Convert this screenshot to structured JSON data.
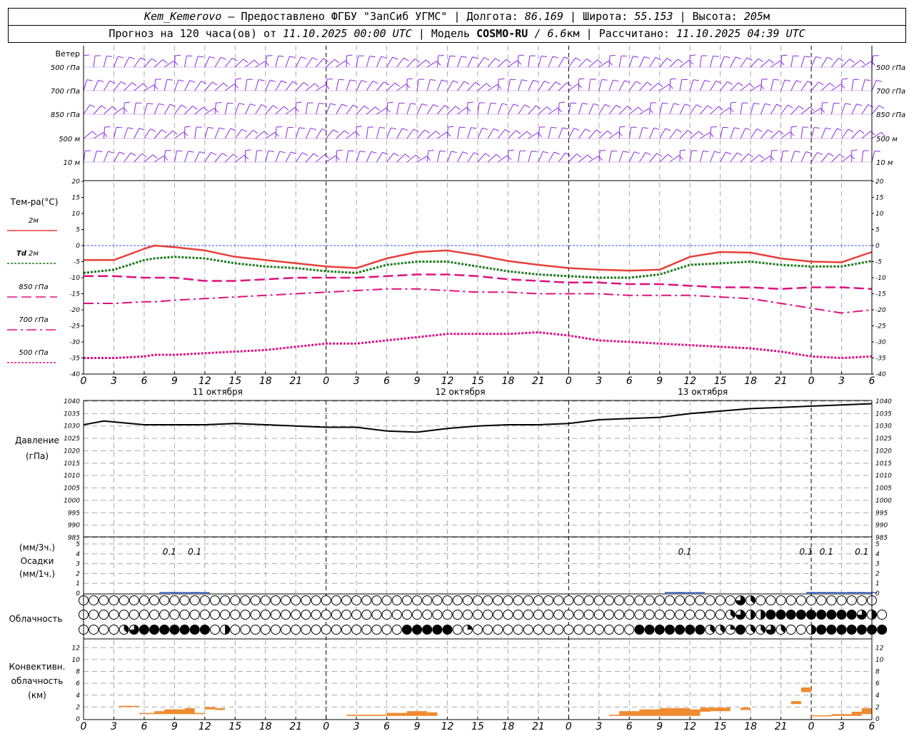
{
  "header": {
    "station": "Kem_Kemerovo",
    "dash": "—",
    "provider": "Предоставлено ФГБУ \"ЗапСиб УГМС\"",
    "sep": "|",
    "lon_label": "Долгота:",
    "lon_value": "86.169",
    "lat_label": "Широта:",
    "lat_value": "55.153",
    "alt_label": "Высота:",
    "alt_value": "205",
    "alt_unit": "м",
    "forecast_label": "Прогноз на 120 часа(ов) от",
    "forecast_start": "11.10.2025 00:00 UTC",
    "model_label": "Модель",
    "model_name": "COSMO-RU",
    "model_res_sep": "/",
    "model_res": "6.6",
    "model_res_unit": "км",
    "computed_label": "Рассчитано:",
    "computed_value": "11.10.2025 04:39 UTC"
  },
  "hour_ticks": [
    "0",
    "3",
    "6",
    "9",
    "12",
    "15",
    "18",
    "21",
    "0",
    "3",
    "6",
    "9",
    "12",
    "15",
    "18",
    "21",
    "0",
    "3",
    "6",
    "9",
    "12",
    "15",
    "18",
    "21",
    "0",
    "3",
    "6"
  ],
  "day_labels": [
    "11 октября",
    "12 октября",
    "13 октября"
  ],
  "colors": {
    "wind": "#8a2be2",
    "t2m": "#e8403a",
    "td2m": "#1a7a1a",
    "t850": "#e0107f",
    "t700": "#e0107f",
    "t500": "#e0107f",
    "zero_line": "#3355ff",
    "pressure": "#000000",
    "precip": "#2255cc",
    "convective": "#f08a30",
    "grid": "#aaaaaa"
  },
  "wind_panel": {
    "title": "Ветер",
    "levels": [
      "500 гПа",
      "700 гПа",
      "850 гПа",
      "500 м",
      "10 м"
    ]
  },
  "temp_panel": {
    "title": "Тем-ра(°C)",
    "legend": [
      {
        "label": "2м",
        "prefix": ""
      },
      {
        "label": "2м",
        "prefix": "Td"
      },
      {
        "label": "850 гПа",
        "prefix": ""
      },
      {
        "label": "700 гПа",
        "prefix": ""
      },
      {
        "label": "500 гПа",
        "prefix": ""
      }
    ],
    "yticks": [
      "20",
      "15",
      "10",
      "5",
      "0",
      "-5",
      "-10",
      "-15",
      "-20",
      "-25",
      "-30",
      "-35",
      "-40"
    ]
  },
  "pressure_panel": {
    "title": "Давление",
    "unit": "(гПа)",
    "yticks": [
      "1040",
      "1035",
      "1030",
      "1025",
      "1020",
      "1015",
      "1010",
      "1005",
      "1000",
      "995",
      "990",
      "985"
    ]
  },
  "precip_panel": {
    "unit1": "(мм/3ч.)",
    "title": "Осадки",
    "unit2": "(мм/1ч.)",
    "yticks": [
      "5",
      "4",
      "3",
      "2",
      "1",
      "0"
    ],
    "labels": [
      {
        "hour": 8.5,
        "text": "0.1"
      },
      {
        "hour": 11,
        "text": "0.1"
      },
      {
        "hour": 59.5,
        "text": "0.1"
      },
      {
        "hour": 71.5,
        "text": "0.1"
      },
      {
        "hour": 73.5,
        "text": "0.1"
      },
      {
        "hour": 77,
        "text": "0.1"
      }
    ]
  },
  "cloud_panel": {
    "title": "Облачность"
  },
  "conv_panel": {
    "title1": "Конвективн.",
    "title2": "облачность",
    "unit": "(км)",
    "yticks": [
      "12",
      "10",
      "8",
      "6",
      "4",
      "2",
      "0"
    ]
  },
  "chart_data": [
    {
      "type": "line",
      "title": "Тем-ра(°C)",
      "x_hours": [
        0,
        3,
        6,
        7,
        9,
        12,
        15,
        18,
        21,
        24,
        27,
        30,
        33,
        36,
        39,
        42,
        45,
        48,
        51,
        54,
        57,
        60,
        63,
        66,
        69,
        72,
        75,
        78
      ],
      "ylim": [
        -40,
        20
      ],
      "series": [
        {
          "name": "2м",
          "values": [
            -4.5,
            -4.5,
            -1,
            0,
            -0.5,
            -1.5,
            -3.5,
            -4.5,
            -5.5,
            -6.5,
            -7,
            -4,
            -2,
            -1.5,
            -3,
            -4.8,
            -6,
            -7,
            -7.5,
            -7.8,
            -7.5,
            -3.5,
            -2,
            -2.2,
            -4,
            -5,
            -5.2,
            -2
          ]
        },
        {
          "name": "Td 2м",
          "values": [
            -8.5,
            -7.5,
            -4.5,
            -4,
            -3.5,
            -4,
            -5.5,
            -6.5,
            -7,
            -8,
            -8.5,
            -6,
            -5,
            -5,
            -6.5,
            -8,
            -9,
            -9.5,
            -10,
            -10,
            -9,
            -6,
            -5.5,
            -5,
            -6,
            -6.5,
            -6.5,
            -4.8
          ]
        },
        {
          "name": "850 гПа",
          "values": [
            -9.5,
            -9.5,
            -10,
            -10,
            -10,
            -11,
            -11,
            -10.5,
            -10,
            -10,
            -10,
            -9.5,
            -9,
            -9,
            -9.5,
            -10.5,
            -11,
            -11.5,
            -11.5,
            -12,
            -12,
            -12.5,
            -13,
            -13,
            -13.5,
            -13,
            -13,
            -13.5
          ]
        },
        {
          "name": "700 гПа",
          "values": [
            -18,
            -18,
            -17.5,
            -17.5,
            -17,
            -16.5,
            -16,
            -15.5,
            -15,
            -14.5,
            -14,
            -13.5,
            -13.5,
            -14,
            -14.5,
            -14.5,
            -15,
            -15,
            -15,
            -15.5,
            -15.5,
            -15.5,
            -16,
            -16.5,
            -18,
            -19.5,
            -21,
            -20
          ]
        },
        {
          "name": "500 гПа",
          "values": [
            -35,
            -35,
            -34.5,
            -34,
            -34,
            -33.5,
            -33,
            -32.5,
            -31.5,
            -30.5,
            -30.5,
            -29.5,
            -28.5,
            -27.5,
            -27.5,
            -27.5,
            -27,
            -28,
            -29.5,
            -30,
            -30.5,
            -31,
            -31.5,
            -32,
            -33,
            -34.5,
            -35,
            -34.5
          ]
        }
      ]
    },
    {
      "type": "line",
      "title": "Давление",
      "x_hours": [
        0,
        2,
        6,
        9,
        12,
        15,
        18,
        21,
        24,
        27,
        30,
        33,
        36,
        39,
        42,
        45,
        48,
        51,
        54,
        57,
        60,
        63,
        66,
        69,
        72,
        75,
        78
      ],
      "ylim": [
        985,
        1040
      ],
      "series": [
        {
          "name": "Давление",
          "values": [
            1030.5,
            1032,
            1030.5,
            1030.5,
            1030.5,
            1031,
            1030.5,
            1030,
            1029.5,
            1029.5,
            1028,
            1027.5,
            1029,
            1030,
            1030.5,
            1030.5,
            1031,
            1032.5,
            1033,
            1033.5,
            1035,
            1036,
            1037,
            1037.5,
            1038,
            1038.5,
            1039
          ]
        }
      ]
    },
    {
      "type": "bar",
      "title": "Осадки",
      "ylim": [
        0,
        5
      ],
      "x_hours": [
        7,
        8,
        9,
        10,
        11,
        12,
        13,
        14,
        57,
        58,
        59,
        60,
        61,
        62,
        63,
        71,
        72,
        73,
        74,
        75,
        76,
        77,
        78
      ],
      "values": [
        0,
        0.05,
        0.1,
        0.05,
        0.1,
        0.05,
        0,
        0,
        0,
        0.05,
        0.1,
        0.05,
        0.05,
        0,
        0,
        0,
        0.1,
        0.1,
        0.1,
        0.05,
        0.1,
        0.1,
        0.05
      ]
    },
    {
      "type": "bar",
      "title": "Конвективн. облачность",
      "ylim": [
        0,
        13
      ],
      "segments": [
        {
          "x0": 3.5,
          "x1": 5.5,
          "bottom": 2.0,
          "top": 2.2
        },
        {
          "x0": 5.5,
          "x1": 7,
          "bottom": 0.8,
          "top": 1.0
        },
        {
          "x0": 7,
          "x1": 8,
          "bottom": 0.8,
          "top": 1.3
        },
        {
          "x0": 8,
          "x1": 10,
          "bottom": 0.8,
          "top": 1.6
        },
        {
          "x0": 10,
          "x1": 11,
          "bottom": 0.8,
          "top": 1.8
        },
        {
          "x0": 11,
          "x1": 12,
          "bottom": 0.8,
          "top": 1.0
        },
        {
          "x0": 12,
          "x1": 13,
          "bottom": 1.6,
          "top": 2.0
        },
        {
          "x0": 13,
          "x1": 14,
          "bottom": 1.5,
          "top": 1.8
        },
        {
          "x0": 26,
          "x1": 30,
          "bottom": 0.5,
          "top": 0.7
        },
        {
          "x0": 30,
          "x1": 32,
          "bottom": 0.5,
          "top": 1.0
        },
        {
          "x0": 32,
          "x1": 34,
          "bottom": 0.5,
          "top": 1.3
        },
        {
          "x0": 34,
          "x1": 35,
          "bottom": 0.5,
          "top": 1.1
        },
        {
          "x0": 52,
          "x1": 53,
          "bottom": 0.5,
          "top": 0.7
        },
        {
          "x0": 53,
          "x1": 55,
          "bottom": 0.5,
          "top": 1.3
        },
        {
          "x0": 55,
          "x1": 57,
          "bottom": 0.5,
          "top": 1.6
        },
        {
          "x0": 57,
          "x1": 60,
          "bottom": 0.5,
          "top": 1.8
        },
        {
          "x0": 60,
          "x1": 61,
          "bottom": 0.5,
          "top": 1.6
        },
        {
          "x0": 61,
          "x1": 62,
          "bottom": 1.2,
          "top": 1.9
        },
        {
          "x0": 62,
          "x1": 64,
          "bottom": 1.3,
          "top": 1.9
        },
        {
          "x0": 65,
          "x1": 66,
          "bottom": 1.5,
          "top": 1.9
        },
        {
          "x0": 70,
          "x1": 71,
          "bottom": 2.5,
          "top": 3.0
        },
        {
          "x0": 71,
          "x1": 72,
          "bottom": 4.5,
          "top": 5.3
        },
        {
          "x0": 72,
          "x1": 74,
          "bottom": 0.5,
          "top": 0.6
        },
        {
          "x0": 74,
          "x1": 76,
          "bottom": 0.5,
          "top": 0.8
        },
        {
          "x0": 76,
          "x1": 77,
          "bottom": 0.5,
          "top": 1.2
        },
        {
          "x0": 77,
          "x1": 78,
          "bottom": 0.8,
          "top": 1.8
        }
      ]
    },
    {
      "type": "table",
      "title": "Облачность",
      "x_hours_from": 0,
      "x_hours_step": 1,
      "rows": [
        {
          "layer": "upper",
          "fill_eighths": [
            0,
            0,
            0,
            0,
            0,
            0,
            0,
            0,
            0,
            0,
            0,
            0,
            0,
            0,
            0,
            0,
            0,
            0,
            0,
            0,
            0,
            0,
            0,
            0,
            0,
            0,
            0,
            0,
            0,
            0,
            0,
            0,
            0,
            0,
            0,
            0,
            0,
            0,
            0,
            0,
            0,
            0,
            0,
            0,
            0,
            0,
            0,
            0,
            0,
            0,
            0,
            0,
            0,
            0,
            0,
            0,
            0,
            0,
            0,
            0,
            0,
            0,
            0,
            0,
            0,
            6,
            3,
            0,
            0,
            0,
            0,
            0,
            0,
            0,
            0,
            0,
            0,
            0,
            0
          ]
        },
        {
          "layer": "middle",
          "fill_eighths": [
            0,
            0,
            0,
            0,
            0,
            0,
            0,
            0,
            0,
            0,
            0,
            0,
            0,
            0,
            0,
            0,
            0,
            0,
            0,
            0,
            0,
            0,
            0,
            0,
            0,
            0,
            0,
            0,
            0,
            0,
            0,
            0,
            0,
            0,
            0,
            0,
            0,
            0,
            0,
            0,
            0,
            0,
            0,
            0,
            0,
            0,
            0,
            0,
            0,
            0,
            0,
            0,
            0,
            0,
            0,
            0,
            0,
            0,
            0,
            0,
            0,
            0,
            0,
            0,
            3,
            6,
            4,
            4,
            8,
            8,
            8,
            8,
            8,
            8,
            8,
            8,
            8,
            6,
            4,
            0
          ]
        },
        {
          "layer": "lower",
          "fill_eighths": [
            0,
            0,
            0,
            0,
            3,
            6,
            8,
            8,
            8,
            8,
            8,
            8,
            8,
            0,
            4,
            0,
            0,
            0,
            0,
            0,
            0,
            0,
            0,
            0,
            0,
            0,
            0,
            0,
            0,
            0,
            0,
            0,
            8,
            8,
            8,
            8,
            8,
            0,
            2,
            0,
            0,
            0,
            0,
            0,
            0,
            0,
            0,
            0,
            0,
            0,
            0,
            0,
            0,
            0,
            0,
            8,
            8,
            8,
            8,
            8,
            8,
            8,
            3,
            3,
            2,
            8,
            3,
            3,
            6,
            3,
            0,
            0,
            4,
            8,
            8,
            8,
            8,
            8,
            8,
            8
          ]
        }
      ]
    }
  ]
}
